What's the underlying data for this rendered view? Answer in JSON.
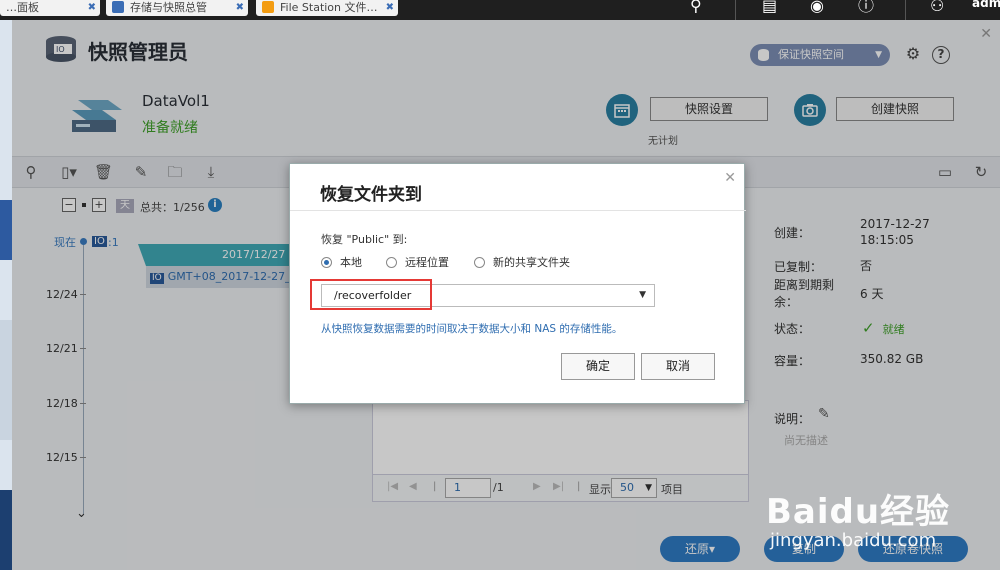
{
  "browser_tabs": [
    {
      "label": "…面板"
    },
    {
      "label": "存储与快照总管"
    },
    {
      "label": "File Station 文件…"
    }
  ],
  "topbar": {
    "user": "adm"
  },
  "app": {
    "title": "快照管理员",
    "guarantee_label": "保证快照空间",
    "colors": {
      "accent": "#2f7bc4",
      "teal": "#2a7fa2",
      "ok": "#3fa02a",
      "highlight": "#e53935"
    }
  },
  "volume": {
    "name": "DataVol1",
    "status": "准备就绪",
    "snapshot_settings_label": "快照设置",
    "no_plan": "无计划",
    "create_snapshot_label": "创建快照"
  },
  "toolbar": {
    "icons": [
      "search-icon",
      "view-icon",
      "delete-icon",
      "edit-icon",
      "folder-icon",
      "download-icon",
      "window-icon",
      "refresh-icon"
    ]
  },
  "timeline": {
    "day_label": "天",
    "total": "总共：1/256",
    "now_label": "现在",
    "now_count": ":1",
    "dates": [
      "12/24",
      "12/21",
      "12/18",
      "12/15"
    ],
    "banner_date": "2017/12/27",
    "snapshot_item": "GMT+08_2017-12-27_1"
  },
  "pager": {
    "page": "1",
    "of_pages": "/1",
    "show_label": "显示",
    "per_page": "50",
    "items_label": "项目"
  },
  "details": {
    "created_label": "创建：",
    "created_value": "2017-12-27",
    "created_time": "18:15:05",
    "copied_label": "已复制：",
    "copied_value": "否",
    "expiry_label": "距离到期剩",
    "expiry_label2": "余：",
    "expiry_value": "6 天",
    "state_label": "状态：",
    "state_value": "就绪",
    "capacity_label": "容量：",
    "capacity_value": "350.82 GB",
    "desc_label": "说明：",
    "desc_value": "尚无描述"
  },
  "bottom_buttons": {
    "restore": "还原",
    "copy": "复制",
    "restore_volume": "还原卷快照"
  },
  "watermark": {
    "text": "Baidu经验",
    "url": "jingyan.baidu.com"
  },
  "dialog": {
    "title": "恢复文件夹到",
    "prompt": "恢复 \"Public\" 到:",
    "options": [
      {
        "label": "本地",
        "selected": true
      },
      {
        "label": "远程位置",
        "selected": false
      },
      {
        "label": "新的共享文件夹",
        "selected": false
      }
    ],
    "path_value": "/recoverfolder",
    "note": "从快照恢复数据需要的时间取决于数据大小和 NAS 的存储性能。",
    "ok_label": "确定",
    "cancel_label": "取消"
  }
}
